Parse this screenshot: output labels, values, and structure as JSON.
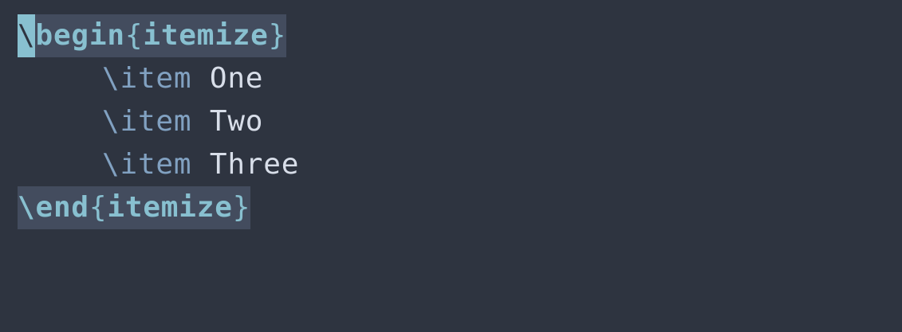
{
  "editor": {
    "lines": {
      "begin": {
        "cursor_char": "\\",
        "command": "begin",
        "open_brace": "{",
        "env": "itemize",
        "close_brace": "}"
      },
      "items": [
        {
          "command": "\\item",
          "text": "One"
        },
        {
          "command": "\\item",
          "text": "Two"
        },
        {
          "command": "\\item",
          "text": "Three"
        }
      ],
      "end": {
        "command": "\\end",
        "open_brace": "{",
        "env": "itemize",
        "close_brace": "}"
      }
    }
  },
  "colors": {
    "background": "#2e3440",
    "highlight": "#434c5e",
    "cursor": "#88c0d0",
    "command": "#88c0d0",
    "item_command": "#81a1c1",
    "text": "#d8dee9"
  }
}
